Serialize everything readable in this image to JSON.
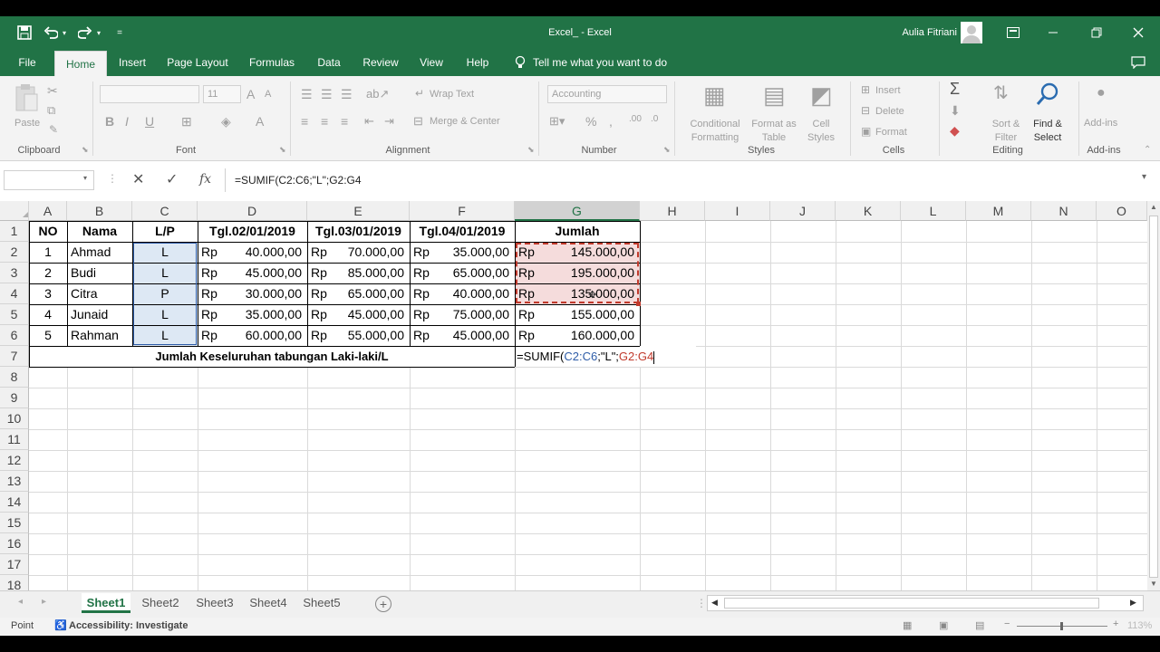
{
  "titlebar": {
    "title": "Excel_  -  Excel",
    "user": "Aulia Fitriani",
    "qat_more": "="
  },
  "tabs": [
    "File",
    "Home",
    "Insert",
    "Page Layout",
    "Formulas",
    "Data",
    "Review",
    "View",
    "Help"
  ],
  "tell_me": "Tell me what you want to do",
  "ribbon": {
    "clipboard": {
      "label": "Clipboard",
      "paste": "Paste"
    },
    "font": {
      "label": "Font",
      "size": "11",
      "grow": "A",
      "shrink": "A",
      "bold": "B",
      "italic": "I",
      "underline": "U",
      "color": "A"
    },
    "alignment": {
      "label": "Alignment",
      "wrap": "Wrap Text",
      "merge": "Merge & Center"
    },
    "number": {
      "label": "Number",
      "format": "Accounting",
      "percent": "%",
      "comma": ","
    },
    "styles": {
      "label": "Styles",
      "conditional": [
        "Conditional",
        "Formatting"
      ],
      "format_table": [
        "Format as",
        "Table"
      ],
      "cell_styles": [
        "Cell",
        "Styles"
      ]
    },
    "cells": {
      "label": "Cells",
      "insert": "Insert",
      "delete": "Delete",
      "format": "Format"
    },
    "editing": {
      "label": "Editing",
      "sort": [
        "Sort &",
        "Filter"
      ],
      "find": [
        "Find &",
        "Select"
      ]
    },
    "addins": {
      "label": "Add-ins",
      "btn": "Add-ins"
    }
  },
  "formula_bar": {
    "name_box": "",
    "formula": "=SUMIF(C2:C6;\"L\";G2:G4",
    "fx": "fx"
  },
  "columns": [
    "A",
    "B",
    "C",
    "D",
    "E",
    "F",
    "G",
    "H",
    "I",
    "J",
    "K",
    "L",
    "M",
    "N",
    "O"
  ],
  "rows": [
    "1",
    "2",
    "3",
    "4",
    "5",
    "6",
    "7",
    "8",
    "9",
    "10",
    "11",
    "12",
    "13",
    "14",
    "15",
    "16",
    "17",
    "18"
  ],
  "sheet": {
    "headers": [
      "NO",
      "Nama",
      "L/P",
      "Tgl.02/01/2019",
      "Tgl.03/01/2019",
      "Tgl.04/01/2019",
      "Jumlah"
    ],
    "currency": "Rp",
    "data": [
      [
        "1",
        "Ahmad",
        "L",
        "40.000,00",
        "70.000,00",
        "35.000,00",
        "145.000,00"
      ],
      [
        "2",
        "Budi",
        "L",
        "45.000,00",
        "85.000,00",
        "65.000,00",
        "195.000,00"
      ],
      [
        "3",
        "Citra",
        "P",
        "30.000,00",
        "65.000,00",
        "40.000,00",
        "135.000,00"
      ],
      [
        "4",
        "Junaid",
        "L",
        "35.000,00",
        "45.000,00",
        "75.000,00",
        "155.000,00"
      ],
      [
        "5",
        "Rahman",
        "L",
        "60.000,00",
        "55.000,00",
        "45.000,00",
        "160.000,00"
      ]
    ],
    "total_label": "Jumlah Keseluruhan tabungan Laki-laki/L",
    "edit_parts": {
      "a": "=SUMIF(",
      "b": "C2:C6",
      "c": ";\"L\";",
      "d": "G2:G4"
    }
  },
  "sheet_tabs": [
    "Sheet1",
    "Sheet2",
    "Sheet3",
    "Sheet4",
    "Sheet5"
  ],
  "active_sheet": "Sheet1",
  "status": {
    "mode": "Point",
    "accessibility": "Accessibility: Investigate",
    "zoom": "113%"
  },
  "colors": {
    "excel_green": "#217346",
    "range_blue": "#2f5da8",
    "range_red": "#c0392b",
    "highlight": "#f5dcdc",
    "selection": "#dde8f4"
  }
}
